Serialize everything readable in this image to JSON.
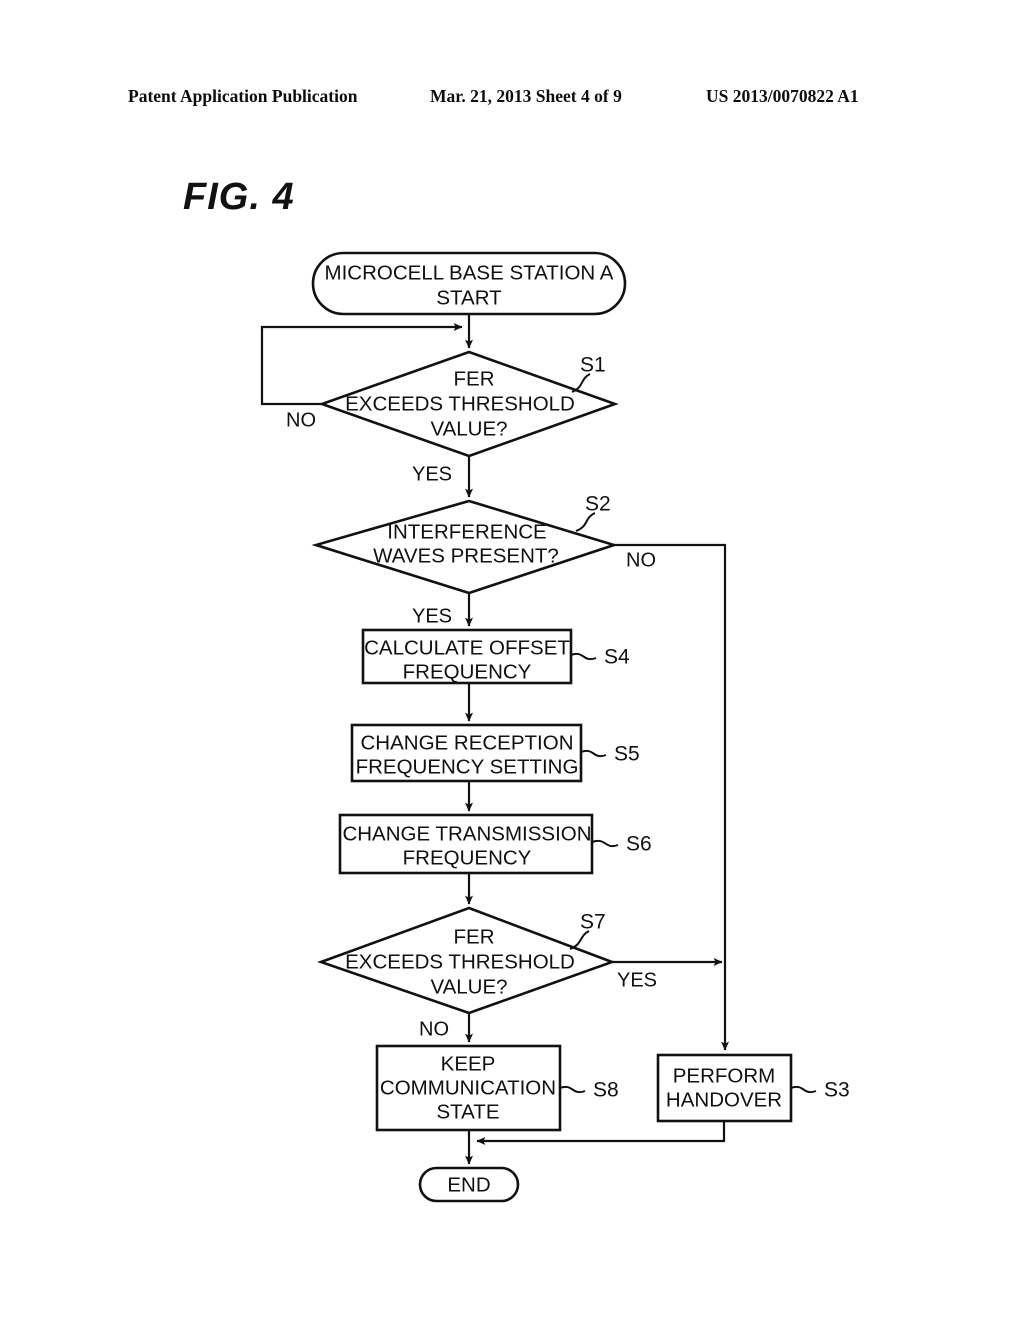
{
  "header": {
    "left": "Patent Application Publication",
    "middle": "Mar. 21, 2013  Sheet 4 of 9",
    "right": "US 2013/0070822 A1"
  },
  "figure": {
    "title": "FIG. 4"
  },
  "flowchart": {
    "nodes": [
      {
        "id": "start",
        "type": "terminator",
        "lines": [
          "MICROCELL BASE STATION A",
          "START"
        ],
        "step": ""
      },
      {
        "id": "s1",
        "type": "decision",
        "lines": [
          "FER",
          "EXCEEDS THRESHOLD",
          "VALUE?"
        ],
        "step": "S1"
      },
      {
        "id": "s2",
        "type": "decision",
        "lines": [
          "INTERFERENCE",
          "WAVES PRESENT?"
        ],
        "step": "S2"
      },
      {
        "id": "s4",
        "type": "process",
        "lines": [
          "CALCULATE OFFSET",
          "FREQUENCY"
        ],
        "step": "S4"
      },
      {
        "id": "s5",
        "type": "process",
        "lines": [
          "CHANGE RECEPTION",
          "FREQUENCY SETTING"
        ],
        "step": "S5"
      },
      {
        "id": "s6",
        "type": "process",
        "lines": [
          "CHANGE TRANSMISSION",
          "FREQUENCY"
        ],
        "step": "S6"
      },
      {
        "id": "s7",
        "type": "decision",
        "lines": [
          "FER",
          "EXCEEDS THRESHOLD",
          "VALUE?"
        ],
        "step": "S7"
      },
      {
        "id": "s8",
        "type": "process",
        "lines": [
          "KEEP",
          "COMMUNICATION",
          "STATE"
        ],
        "step": "S8"
      },
      {
        "id": "s3",
        "type": "process",
        "lines": [
          "PERFORM",
          "HANDOVER"
        ],
        "step": "S3"
      },
      {
        "id": "end",
        "type": "terminator",
        "lines": [
          "END"
        ],
        "step": ""
      }
    ],
    "edge_labels": {
      "s1_no": "NO",
      "s1_yes": "YES",
      "s2_no": "NO",
      "s2_yes": "YES",
      "s7_yes": "YES",
      "s7_no": "NO"
    },
    "step_labels": {
      "s1": "S1",
      "s2": "S2",
      "s3": "S3",
      "s4": "S4",
      "s5": "S5",
      "s6": "S6",
      "s7": "S7",
      "s8": "S8"
    },
    "node_text": {
      "start_l1": "MICROCELL BASE STATION A",
      "start_l2": "START",
      "s1_l1": "FER",
      "s1_l2": "EXCEEDS THRESHOLD",
      "s1_l3": "VALUE?",
      "s2_l1": "INTERFERENCE",
      "s2_l2": "WAVES PRESENT?",
      "s4_l1": "CALCULATE OFFSET",
      "s4_l2": "FREQUENCY",
      "s5_l1": "CHANGE RECEPTION",
      "s5_l2": "FREQUENCY SETTING",
      "s6_l1": "CHANGE TRANSMISSION",
      "s6_l2": "FREQUENCY",
      "s7_l1": "FER",
      "s7_l2": "EXCEEDS THRESHOLD",
      "s7_l3": "VALUE?",
      "s8_l1": "KEEP",
      "s8_l2": "COMMUNICATION",
      "s8_l3": "STATE",
      "s3_l1": "PERFORM",
      "s3_l2": "HANDOVER",
      "end_l1": "END"
    },
    "colors": {
      "ink": "#111111",
      "paper": "#ffffff"
    }
  }
}
